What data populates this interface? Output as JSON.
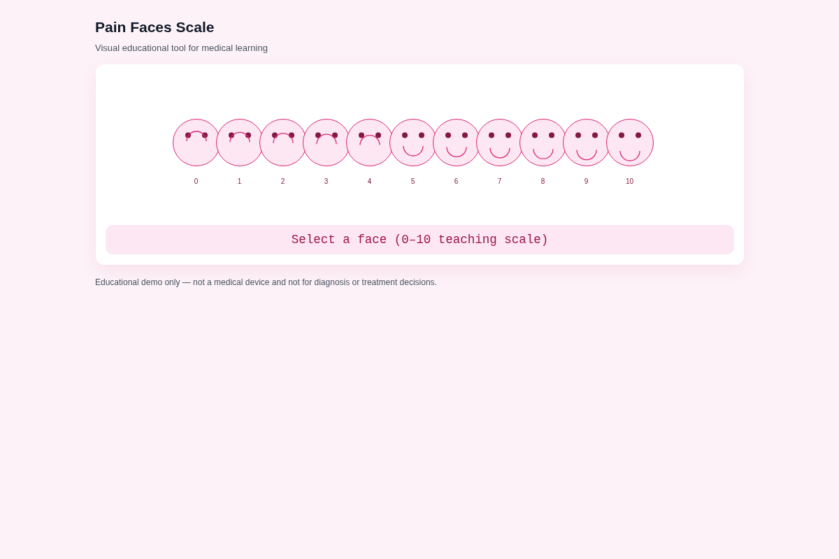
{
  "header": {
    "title": "Pain Faces Scale",
    "subtitle": "Visual educational tool for medical learning"
  },
  "faces": [
    {
      "label": "0",
      "kind": "frown",
      "selected": false
    },
    {
      "label": "1",
      "kind": "frown",
      "selected": false
    },
    {
      "label": "2",
      "kind": "frown",
      "selected": false
    },
    {
      "label": "3",
      "kind": "frown",
      "selected": false
    },
    {
      "label": "4",
      "kind": "frown",
      "selected": false
    },
    {
      "label": "5",
      "kind": "smile",
      "selected": false
    },
    {
      "label": "6",
      "kind": "smile",
      "selected": false
    },
    {
      "label": "7",
      "kind": "smile",
      "selected": false
    },
    {
      "label": "8",
      "kind": "smile",
      "selected": false
    },
    {
      "label": "9",
      "kind": "smile",
      "selected": false
    },
    {
      "label": "10",
      "kind": "smile",
      "selected": false
    }
  ],
  "status": "Select a face (0–10 teaching scale)",
  "disclaimer": "Educational demo only — not a medical device and not for diagnosis or treatment decisions."
}
